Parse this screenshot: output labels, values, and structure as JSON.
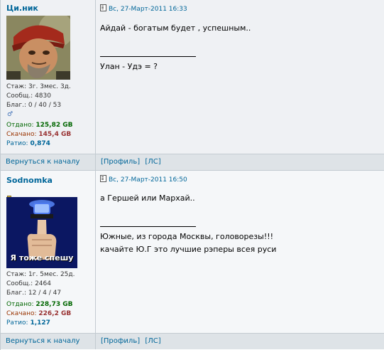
{
  "posts": [
    {
      "author": "Ци.ник",
      "stats": {
        "stazh": "Стаж: 3г. 3мес. 3д.",
        "soobsch": "Сообщ.: 4830",
        "blag": "Благ.: 0 / 40 / 53",
        "otdano_label": "Отдано:",
        "otdano_value": "125,82 GB",
        "skachano_label": "Скачано:",
        "skachano_value": "145,4 GB",
        "ratio_label": "Ратио:",
        "ratio_value": "0,874"
      },
      "date": "Вс, 27-Март-2011 16:33",
      "lines": [
        "Айдай - богатым будет , успешным..",
        "Улан - Удэ = ?"
      ],
      "back_link": "Вернуться к началу",
      "profile_link": "[Профиль]",
      "pm_link": "[ЛС]"
    },
    {
      "author": "Sodnomka",
      "avatar_caption": "Я тоже спешу",
      "stats": {
        "stazh": "Стаж: 1г. 5мес. 25д.",
        "soobsch": "Сообщ.: 2464",
        "blag": "Благ.: 12 / 4 / 47",
        "otdano_label": "Отдано:",
        "otdano_value": "228,73 GB",
        "skachano_label": "Скачано:",
        "skachano_value": "226,2 GB",
        "ratio_label": "Ратио:",
        "ratio_value": "1,127"
      },
      "date": "Вс, 27-Март-2011 16:50",
      "lines": [
        "а Гершей или Мархай..",
        "Южные, из города Москвы, головорезы!!!",
        "качайте Ю.Г это лучшие рэперы всея руси"
      ],
      "back_link": "Вернуться к началу",
      "profile_link": "[Профиль]",
      "pm_link": "[ЛС]"
    }
  ],
  "colors": {
    "link": "#006699",
    "row_bg": "#eff1f4",
    "footer_bg": "#dee3e7",
    "border": "#c3cbd1",
    "upload_green": "#006600",
    "download_red": "#993333"
  }
}
